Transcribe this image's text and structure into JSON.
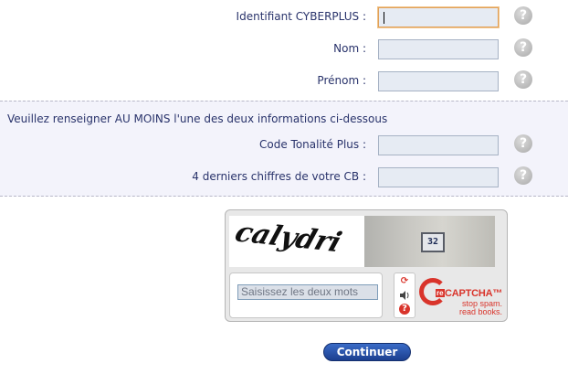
{
  "form": {
    "fields": [
      {
        "label": "Identifiant CYBERPLUS :",
        "value": "",
        "help": "?"
      },
      {
        "label": "Nom :",
        "value": "",
        "help": "?"
      },
      {
        "label": "Prénom :",
        "value": "",
        "help": "?"
      }
    ],
    "alt_note": "Veuillez renseigner AU MOINS l'une des deux informations ci-dessous",
    "alt_fields": [
      {
        "label": "Code Tonalité Plus :",
        "value": "",
        "help": "?"
      },
      {
        "label": "4 derniers chiffres de votre CB :",
        "value": "",
        "help": "?"
      }
    ]
  },
  "captcha": {
    "word_image_text": "calydri",
    "photo_text": "32",
    "input_value": "Saisissez les deux mots",
    "controls": [
      {
        "name": "refresh-icon",
        "glyph": "⟳",
        "color": "#d9342b"
      },
      {
        "name": "audio-icon",
        "glyph": "🔊",
        "color": "#555555"
      },
      {
        "name": "help-icon",
        "glyph": "?",
        "color": "#d9342b"
      }
    ],
    "brand_re": "re",
    "brand_name": "CAPTCHA™",
    "tagline_1": "stop spam.",
    "tagline_2": "read books."
  },
  "submit_label": "Continuer",
  "colors": {
    "label": "#29336b",
    "field_bg": "#e6ebf3",
    "focus_border": "#e0a05a",
    "button": "#1c3f8f",
    "recaptcha_red": "#d9342b"
  }
}
